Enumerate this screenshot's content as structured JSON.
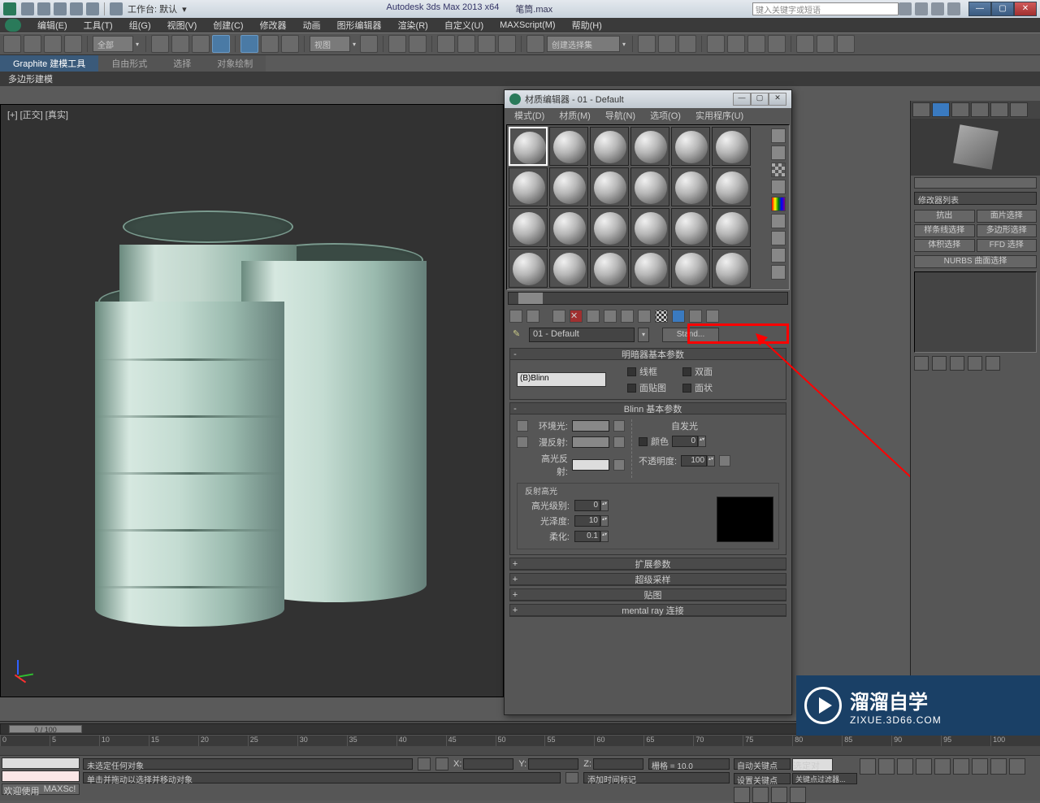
{
  "titlebar": {
    "workspace": "工作台: 默认",
    "app": "Autodesk 3ds Max  2013 x64",
    "file": "笔筒.max",
    "search_placeholder": "键入关键字或短语",
    "min": "—",
    "max": "▢",
    "close": "✕"
  },
  "menubar": [
    "编辑(E)",
    "工具(T)",
    "组(G)",
    "视图(V)",
    "创建(C)",
    "修改器",
    "动画",
    "图形编辑器",
    "渲染(R)",
    "自定义(U)",
    "MAXScript(M)",
    "帮助(H)"
  ],
  "toolbar": {
    "sel_filter": "全部",
    "view_drop": "视图",
    "named_sel": "创建选择集"
  },
  "graphite": {
    "tab": "Graphite 建模工具",
    "tab2": "自由形式",
    "tab3": "选择",
    "tab4": "对象绘制",
    "sub": "多边形建模"
  },
  "viewport": {
    "label": "[+] [正交] [真实]"
  },
  "mat": {
    "title": "材质编辑器 - 01 - Default",
    "menu": [
      "模式(D)",
      "材质(M)",
      "导航(N)",
      "选项(O)",
      "实用程序(U)"
    ],
    "name": "01 - Default",
    "type": "Stand...",
    "r_shader": "明暗器基本参数",
    "shader": "(B)Blinn",
    "chk": {
      "wire": "线框",
      "two": "双面",
      "face": "面贴图",
      "facet": "面状"
    },
    "r_blinn": "Blinn 基本参数",
    "ambient": "环境光:",
    "diffuse": "漫反射:",
    "specular": "高光反射:",
    "selfillum": "自发光",
    "color": "颜色",
    "color_v": "0",
    "opacity": "不透明度:",
    "opacity_v": "100",
    "spec": "反射高光",
    "level": "高光级别:",
    "level_v": "0",
    "gloss": "光泽度:",
    "gloss_v": "10",
    "soften": "柔化:",
    "soften_v": "0.1",
    "r_ext": "扩展参数",
    "r_super": "超级采样",
    "r_maps": "贴图",
    "r_mr": "mental ray 连接"
  },
  "cmd": {
    "modlist": "修改器列表",
    "btn": [
      "抗出",
      "面片选择",
      "样条线选择",
      "多边形选择",
      "体积选择",
      "FFD 选择"
    ],
    "nurbs": "NURBS 曲面选择"
  },
  "timeline": {
    "slider": "0 / 100",
    "ticks": [
      "0",
      "5",
      "10",
      "15",
      "20",
      "25",
      "30",
      "35",
      "40",
      "45",
      "50",
      "55",
      "60",
      "65",
      "70",
      "75",
      "80",
      "85",
      "90",
      "95",
      "100"
    ]
  },
  "status": {
    "script": "MAXSc!",
    "welcome": "欢迎使用",
    "sel": "未选定任何对象",
    "hint": "单击并拖动以选择并移动对象",
    "x": "X:",
    "y": "Y:",
    "z": "Z:",
    "grid": "栅格 = 10.0",
    "addtime": "添加时间标记",
    "autokey": "自动关键点",
    "selset": "选定对",
    "setkey": "设置关键点",
    "filter": "关键点过滤器..."
  },
  "watermark": {
    "t1": "溜溜自学",
    "t2": "ZIXUE.3D66.COM"
  }
}
